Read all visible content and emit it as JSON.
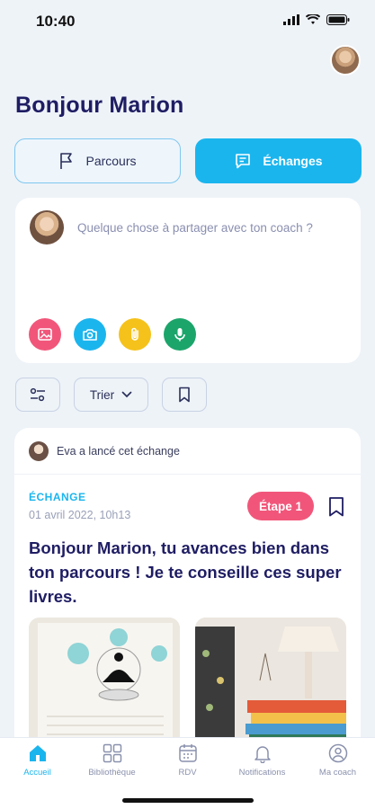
{
  "status_bar": {
    "time": "10:40"
  },
  "header": {
    "greeting": "Bonjour Marion"
  },
  "segments": {
    "parcours": "Parcours",
    "echanges": "Échanges"
  },
  "composer": {
    "placeholder": "Quelque chose à partager avec ton coach ?"
  },
  "filters": {
    "sort_label": "Trier"
  },
  "card": {
    "launcher": "Eva a lancé cet échange",
    "type": "ÉCHANGE",
    "date": "01 avril 2022, 10h13",
    "badge": "Étape 1",
    "text": "Bonjour Marion, tu avances bien dans ton parcours ! Je te conseille ces super livres."
  },
  "tabbar": {
    "items": [
      {
        "label": "Accueil",
        "icon": "home-icon",
        "active": true
      },
      {
        "label": "Bibliothèque",
        "icon": "grid-icon",
        "active": false
      },
      {
        "label": "RDV",
        "icon": "calendar-icon",
        "active": false
      },
      {
        "label": "Notifications",
        "icon": "bell-icon",
        "active": false
      },
      {
        "label": "Ma coach",
        "icon": "user-circle-icon",
        "active": false
      }
    ]
  },
  "colors": {
    "accent": "#1bb5ee",
    "title": "#1f1d63",
    "badge": "#f1567a",
    "background": "#eef3f8"
  }
}
